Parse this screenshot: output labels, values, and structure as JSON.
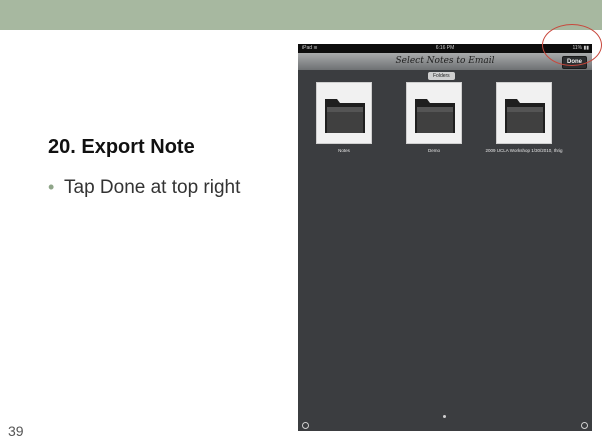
{
  "slide": {
    "title": "20. Export Note",
    "bullets": [
      {
        "text": "Tap Done at top right"
      }
    ],
    "number": "39"
  },
  "ipad": {
    "status": {
      "carrier": "iPad ≋",
      "time": "6:16 PM",
      "battery": "11% ▮▮"
    },
    "nav_title": "Select Notes to Email",
    "done_label": "Done",
    "folders_tab": "Folders",
    "folders": [
      {
        "label": "Notes"
      },
      {
        "label": "Demo"
      },
      {
        "label": "2009 UCLA Workshop 1/30/2010, Ihrig"
      }
    ]
  },
  "colors": {
    "top_band": "#a7b8a0",
    "highlight_circle": "#c8473c"
  }
}
